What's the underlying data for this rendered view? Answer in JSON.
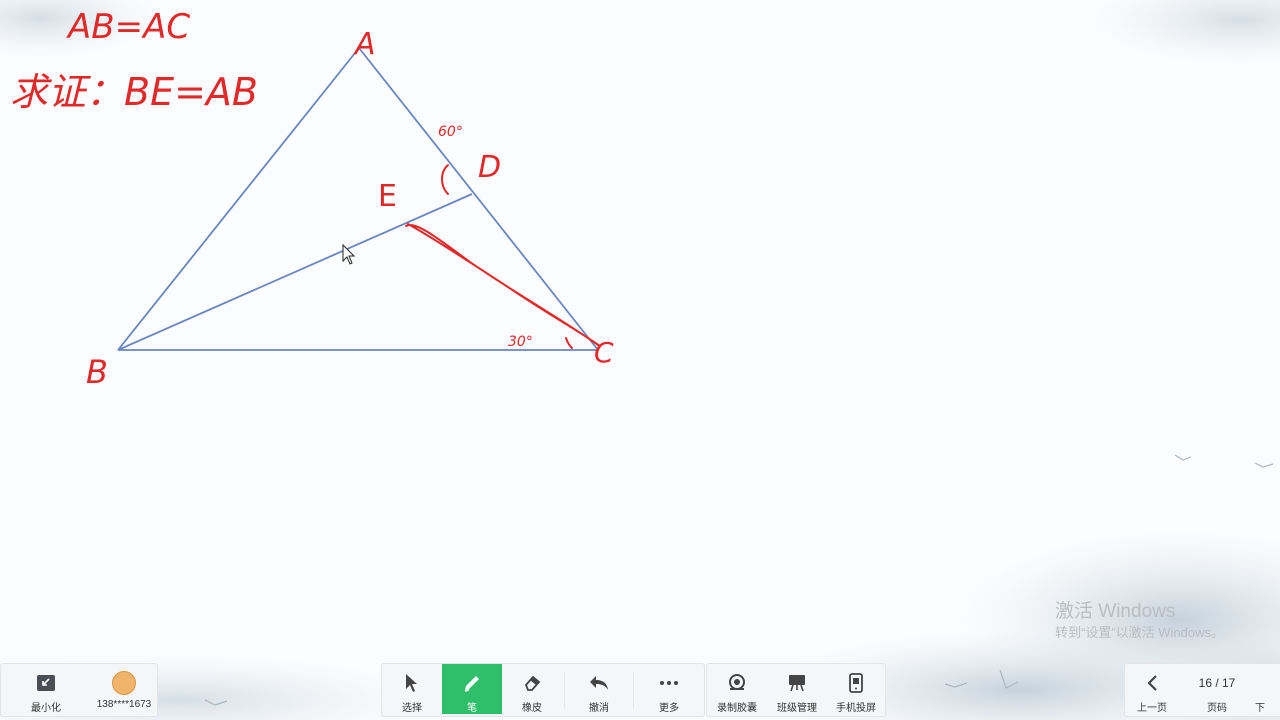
{
  "board": {
    "notes": {
      "given": "AB=AC",
      "prove": "求证：BE=AB"
    },
    "labels": {
      "A": "A",
      "B": "B",
      "C": "C",
      "D": "D",
      "E": "E",
      "angle_60": "60°",
      "angle_30": "30°"
    },
    "ink_color": "#e02a2a",
    "line_color": "#6a86c0"
  },
  "watermark": {
    "title": "激活 Windows",
    "subtitle": "转到“设置”以激活 Windows。"
  },
  "left_panel": {
    "minimize_label": "最小化",
    "user_label": "138****1673"
  },
  "toolbar": {
    "select_label": "选择",
    "pen_label": "笔",
    "eraser_label": "橡皮",
    "undo_label": "撤消",
    "more_label": "更多",
    "record_label": "录制胶囊",
    "class_label": "班级管理",
    "phone_label": "手机投屏",
    "accent": "#2fbf6a"
  },
  "pager": {
    "page_indicator": "16 / 17",
    "prev_label": "上一页",
    "page_label": "页码",
    "next_label": "下"
  }
}
